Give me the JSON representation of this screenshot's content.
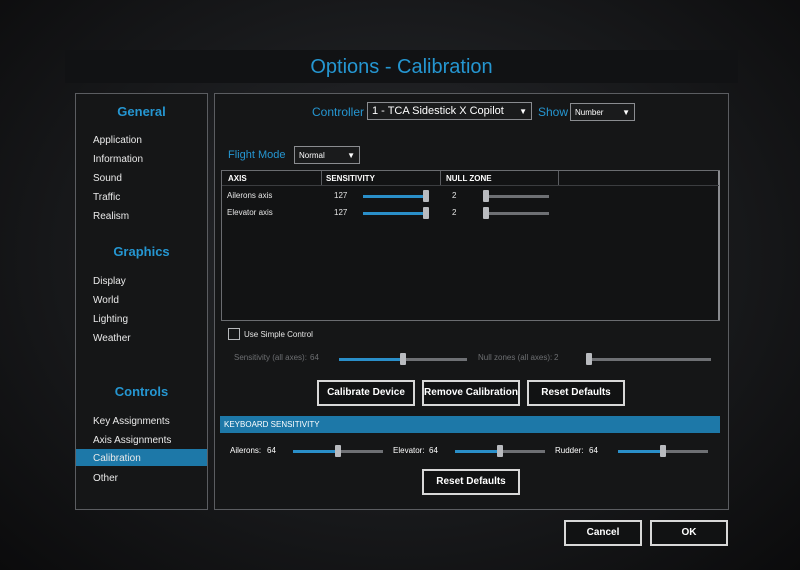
{
  "window": {
    "title": "Options - Calibration"
  },
  "sidebar": {
    "sections": [
      {
        "title": "General",
        "items": [
          "Application",
          "Information",
          "Sound",
          "Traffic",
          "Realism"
        ]
      },
      {
        "title": "Graphics",
        "items": [
          "Display",
          "World",
          "Lighting",
          "Weather"
        ]
      },
      {
        "title": "Controls",
        "items": [
          "Key Assignments",
          "Axis Assignments",
          "Calibration",
          "Other"
        ]
      }
    ],
    "selected": "Calibration"
  },
  "controller": {
    "label": "Controller",
    "value": "1 - TCA Sidestick X Copilot"
  },
  "show": {
    "label": "Show",
    "value": "Number"
  },
  "flight_mode": {
    "label": "Flight Mode",
    "value": "Normal"
  },
  "axis_table": {
    "headers": [
      "AXIS",
      "SENSITIVITY",
      "NULL ZONE"
    ],
    "rows": [
      {
        "axis": "Ailerons axis",
        "sensitivity": "127",
        "sensitivity_fraction": 1.0,
        "null_zone": "2",
        "null_zone_fraction": 0.0
      },
      {
        "axis": "Elevator axis",
        "sensitivity": "127",
        "sensitivity_fraction": 1.0,
        "null_zone": "2",
        "null_zone_fraction": 0.0
      }
    ]
  },
  "simple_control": {
    "label": "Use Simple Control",
    "checked": false,
    "sensitivity_label": "Sensitivity (all axes):",
    "sensitivity_value": "64",
    "sensitivity_fraction": 0.5,
    "nullzone_label": "Null zones (all axes):",
    "nullzone_value": "2",
    "nullzone_fraction": 0.0
  },
  "buttons": {
    "calibrate": "Calibrate Device",
    "remove": "Remove Calibration",
    "reset_top": "Reset Defaults",
    "reset_bottom": "Reset Defaults",
    "cancel": "Cancel",
    "ok": "OK"
  },
  "keyboard": {
    "title": "KEYBOARD SENSITIVITY",
    "ailerons": {
      "label": "Ailerons:",
      "value": "64",
      "fraction": 0.5
    },
    "elevator": {
      "label": "Elevator:",
      "value": "64",
      "fraction": 0.5
    },
    "rudder": {
      "label": "Rudder:",
      "value": "64",
      "fraction": 0.5
    }
  },
  "colors": {
    "accent": "#2596d1",
    "selection": "#1d78a8",
    "slider_fill": "#2a8fc9"
  }
}
